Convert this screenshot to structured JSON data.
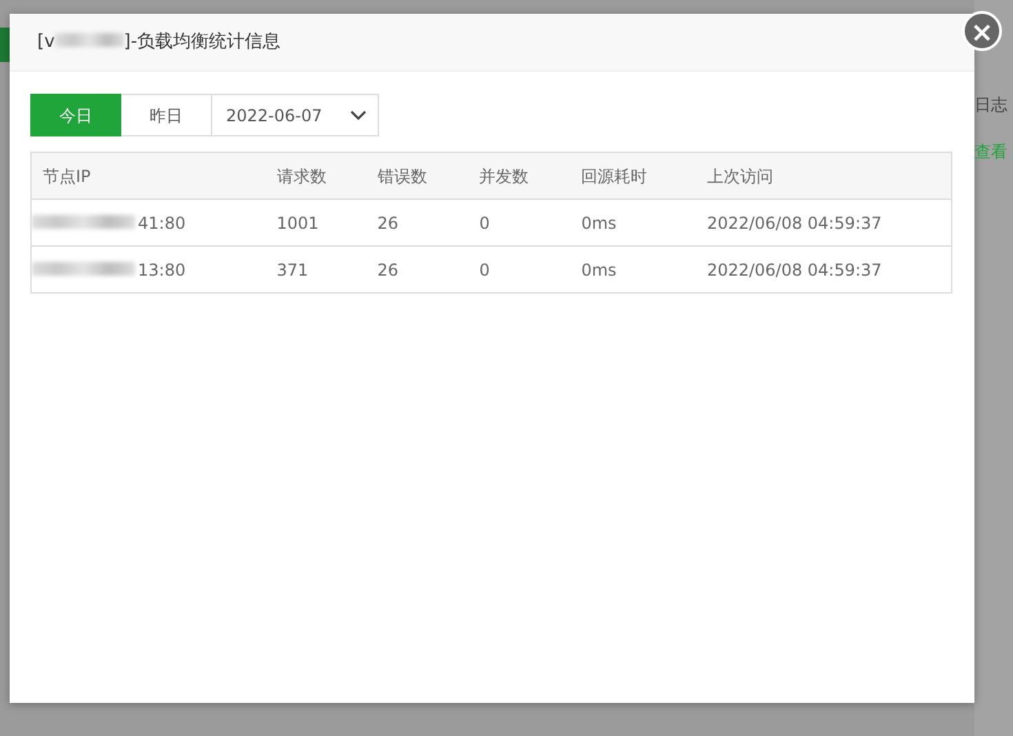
{
  "background": {
    "texts": [
      {
        "text": "日志",
        "kind": "plain"
      },
      {
        "text": "查看",
        "kind": "link"
      }
    ]
  },
  "dialog": {
    "title_prefix": "[v",
    "title_suffix": "]-负载均衡统计信息",
    "close": "×",
    "periods": [
      {
        "label": "今日",
        "selected": true
      },
      {
        "label": "昨日",
        "selected": false
      }
    ],
    "date": "2022-06-07",
    "table": {
      "columns": [
        "节点IP",
        "请求数",
        "错误数",
        "并发数",
        "回源耗时",
        "上次访问"
      ],
      "rows": [
        [
          "41:80",
          "1001",
          "26",
          "0",
          "0ms",
          "2022/06/08 04:59:37"
        ],
        [
          "13:80",
          "371",
          "26",
          "0",
          "0ms",
          "2022/06/08 04:59:37"
        ]
      ]
    }
  }
}
